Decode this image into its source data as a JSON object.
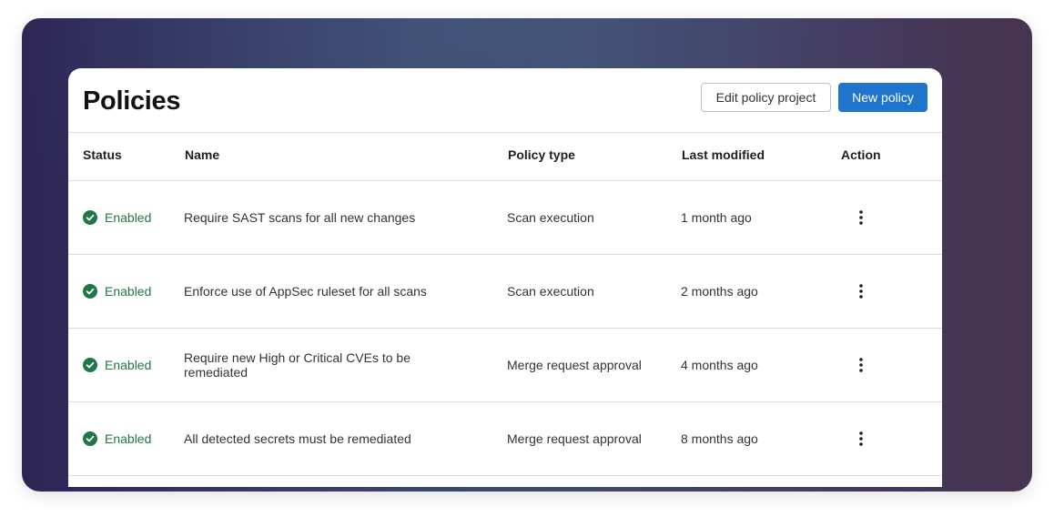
{
  "header": {
    "title": "Policies",
    "edit_button": "Edit policy project",
    "new_button": "New policy"
  },
  "table": {
    "columns": [
      "Status",
      "Name",
      "Policy type",
      "Last modified",
      "Action"
    ],
    "rows": [
      {
        "status": "Enabled",
        "name": "Require SAST scans for all new changes",
        "type": "Scan execution",
        "modified": "1 month ago"
      },
      {
        "status": "Enabled",
        "name": "Enforce use of AppSec ruleset for all scans",
        "type": "Scan execution",
        "modified": "2 months ago"
      },
      {
        "status": "Enabled",
        "name": "Require new High or Critical CVEs to be remediated",
        "type": "Merge request approval",
        "modified": "4 months ago"
      },
      {
        "status": "Enabled",
        "name": "All detected secrets must be remediated",
        "type": "Merge request approval",
        "modified": "8 months ago"
      }
    ]
  },
  "icons": {
    "status": "check-circle-icon",
    "action": "ellipsis-vertical-icon"
  },
  "colors": {
    "primary": "#1f75cb",
    "enabled": "#217645"
  }
}
